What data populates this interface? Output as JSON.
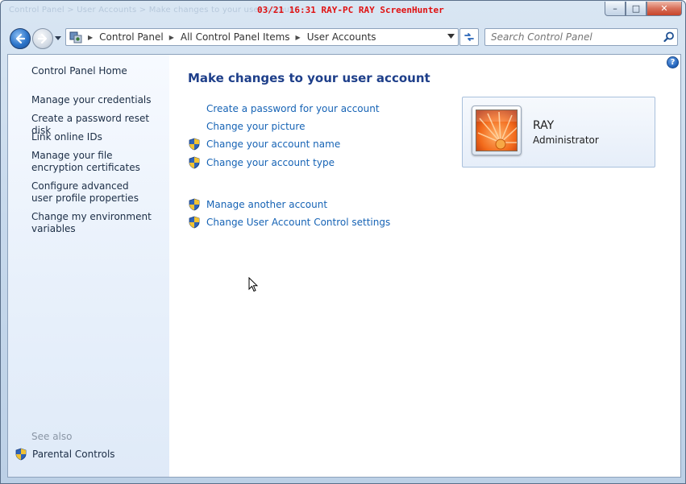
{
  "window": {
    "ghost_title": "Control Panel > User Accounts > Make changes to your user account",
    "overlay": "03/21  16:31  RAY-PC  RAY  ScreenHunter",
    "caption_buttons": {
      "minimize": "–",
      "maximize": "□",
      "close": "✕"
    }
  },
  "address": {
    "crumbs": [
      "Control Panel",
      "All Control Panel Items",
      "User Accounts"
    ]
  },
  "search": {
    "placeholder": "Search Control Panel"
  },
  "help": "?",
  "sidebar": {
    "home": "Control Panel Home",
    "links": [
      "Manage your credentials",
      "Create a password reset disk",
      "Link online IDs",
      "Manage your file encryption certificates",
      "Configure advanced user profile properties",
      "Change my environment variables"
    ],
    "see_also": "See also",
    "parental_controls": "Parental Controls"
  },
  "main": {
    "heading": "Make changes to your user account",
    "tasks": [
      {
        "label": "Create a password for your account",
        "shield": false
      },
      {
        "label": "Change your picture",
        "shield": false
      },
      {
        "label": "Change your account name",
        "shield": true
      },
      {
        "label": "Change your account type",
        "shield": true
      },
      {
        "label": "Manage another account",
        "shield": true
      },
      {
        "label": "Change User Account Control settings",
        "shield": true
      }
    ]
  },
  "account": {
    "name": "RAY",
    "role": "Administrator"
  },
  "colors": {
    "link": "#1663b5",
    "heading": "#1e3f8a",
    "overlay": "#e01010"
  },
  "icons": [
    "back-arrow-icon",
    "forward-arrow-icon",
    "control-panel-icon",
    "refresh-icon",
    "search-icon",
    "help-icon",
    "uac-shield-icon",
    "cursor-icon"
  ]
}
